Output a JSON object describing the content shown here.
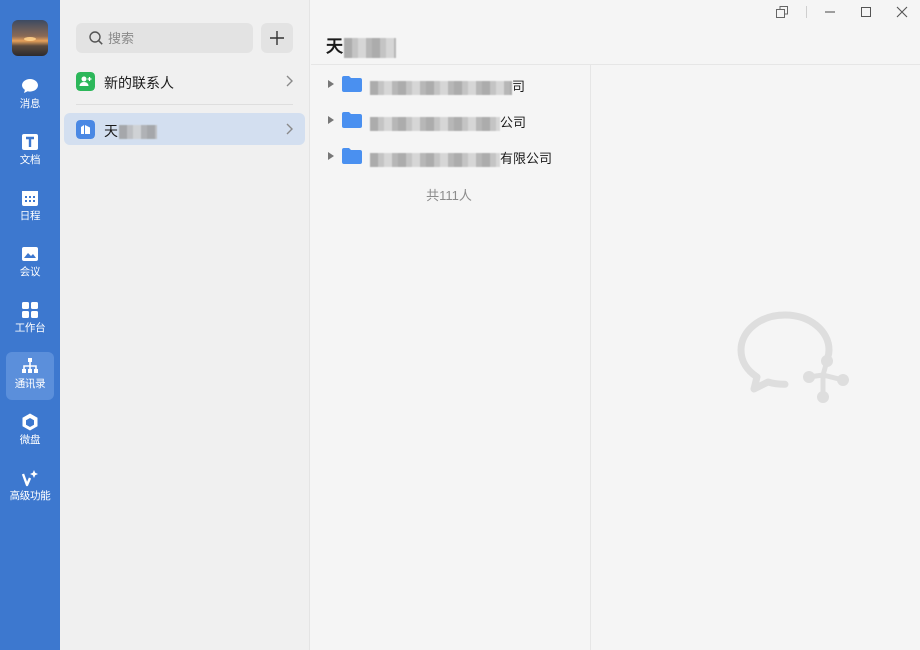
{
  "colors": {
    "rail": "#3d78cf",
    "rail_active": "#5b8fdb",
    "selected_row": "#d3dff0",
    "new_contact_green": "#2cb75a",
    "org_blue": "#4a88e4",
    "folder_blue": "#4a90f0"
  },
  "nav": {
    "items": [
      {
        "label": "消息",
        "icon": "chat-bubble-icon"
      },
      {
        "label": "文档",
        "icon": "document-icon"
      },
      {
        "label": "日程",
        "icon": "calendar-icon"
      },
      {
        "label": "会议",
        "icon": "meeting-icon"
      },
      {
        "label": "工作台",
        "icon": "workbench-grid-icon"
      },
      {
        "label": "通讯录",
        "icon": "org-chart-icon",
        "active": true
      },
      {
        "label": "微盘",
        "icon": "drive-icon"
      },
      {
        "label": "高级功能",
        "icon": "sparkle-icon"
      }
    ]
  },
  "search": {
    "placeholder": "搜索"
  },
  "contacts": {
    "new_contacts_label": "新的联系人",
    "org_label_prefix": "天"
  },
  "header": {
    "title_prefix": "天"
  },
  "tree": {
    "items": [
      {
        "suffix": "司",
        "icon": "folder-icon"
      },
      {
        "suffix": "公司",
        "icon": "folder-icon"
      },
      {
        "suffix": "有限公司",
        "icon": "folder-icon"
      }
    ],
    "total_text": "共111人"
  }
}
